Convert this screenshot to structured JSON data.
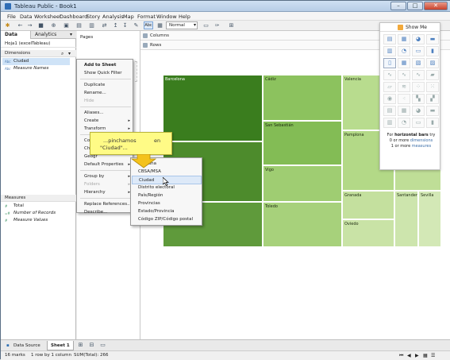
{
  "window": {
    "title": "Tableau Public - Book1",
    "min": "–",
    "max": "□",
    "close": "✕"
  },
  "menubar": [
    "File",
    "Data",
    "Worksheet",
    "Dashboard",
    "Story",
    "Analysis",
    "Map",
    "Format",
    "Window",
    "Help"
  ],
  "toolbar": {
    "abc_label": "Abc",
    "fit_select": "Normal"
  },
  "left_pane": {
    "tabs": [
      "Data",
      "Analytics"
    ],
    "source": "Hoja1 (excelTableau)",
    "dimensions_header": "Dimensions",
    "dimensions": [
      {
        "type": "Abc",
        "name": "Ciudad"
      },
      {
        "type": "Abc",
        "name": "Measure Names"
      }
    ],
    "measures_header": "Measures",
    "measures": [
      {
        "type": "#",
        "name": "Total"
      },
      {
        "type": "=#",
        "name": "Number of Records"
      },
      {
        "type": "#",
        "name": "Measure Values"
      }
    ]
  },
  "mid_pane": {
    "pages": "Pages"
  },
  "shelves": {
    "columns": "Columns",
    "rows": "Rows"
  },
  "treemap": {
    "tiles": [
      {
        "label": "Barcelona",
        "color": "#3a7d1e"
      },
      {
        "label": "Cádiz",
        "color": "#8cc25e"
      },
      {
        "label": "San Sebastián",
        "color": "#83bc55"
      },
      {
        "label": "Valencia",
        "color": "#b8dc8e"
      },
      {
        "label": "",
        "color": "#c9e3a5"
      },
      {
        "label": "",
        "color": "#c3e09b"
      },
      {
        "label": "",
        "color": "#4d8b2c"
      },
      {
        "label": "",
        "color": "#5f9a3b"
      },
      {
        "label": "Vigo",
        "color": "#9fcd72"
      },
      {
        "label": "Pamplona",
        "color": "#b3d987"
      },
      {
        "label": "",
        "color": "#bfde97"
      },
      {
        "label": "",
        "color": "#6aa645"
      },
      {
        "label": "Toledo",
        "color": "#a7d17b"
      },
      {
        "label": "Granada",
        "color": "#c4e09e"
      },
      {
        "label": "Santander",
        "color": "#cde5ad"
      },
      {
        "label": "Sevilla",
        "color": "#d3e8b6"
      },
      {
        "label": "Oviedo",
        "color": "#c9e3a6"
      }
    ]
  },
  "show_me": {
    "title": "Show Me",
    "hint_line1": "For ",
    "hint_bold": "horizontal bars",
    "hint_line1b": " try",
    "hint_line2": "0 or more ",
    "hint_line2b": "dimensions",
    "hint_line3": "1 or more ",
    "hint_line3b": "measures"
  },
  "context_menu": {
    "items": [
      {
        "label": "Add to Sheet",
        "bold": true
      },
      {
        "label": "Show Quick Filter"
      },
      {
        "sep": true
      },
      {
        "label": "Duplicate"
      },
      {
        "label": "Rename..."
      },
      {
        "label": "Hide",
        "disabled": true
      },
      {
        "sep": true
      },
      {
        "label": "Aliases..."
      },
      {
        "label": "Create",
        "arrow": true
      },
      {
        "label": "Transform",
        "arrow": true
      },
      {
        "sep": true
      },
      {
        "label": "Co"
      },
      {
        "label": "Ch"
      },
      {
        "label": "Geogr"
      },
      {
        "label": "Default Properties",
        "arrow": true
      },
      {
        "sep": true
      },
      {
        "label": "Group by",
        "arrow": true
      },
      {
        "label": "Folders",
        "arrow": true,
        "disabled": true
      },
      {
        "label": "Hierarchy",
        "arrow": true
      },
      {
        "sep": true
      },
      {
        "label": "Replace References..."
      },
      {
        "label": "Describe..."
      }
    ]
  },
  "geo_submenu": {
    "items": [
      "Ninguna",
      "CBSA/MSA",
      "Ciudad",
      "Distrito electoral",
      "País/Región",
      "Provincias",
      "Estado/Provincia",
      "Código ZIP/Código postal"
    ],
    "highlighted": "Ciudad"
  },
  "callout": {
    "line1": "...pinchamos",
    "line1b": "en",
    "line2": "\"Ciudad\"..."
  },
  "sheet_tabs": {
    "data_source": "Data Source",
    "sheet": "Sheet 1"
  },
  "status": {
    "marks": "16 marks",
    "rows": "1 row by 1 column",
    "sum": "SUM(Total): 266"
  },
  "colors": {
    "accent": "#3a7d1e",
    "menu_highlight": "#dde9f8"
  }
}
